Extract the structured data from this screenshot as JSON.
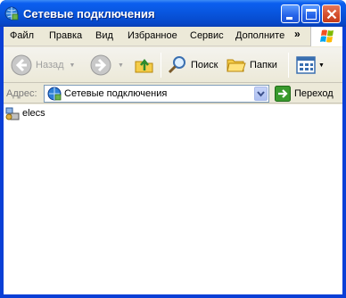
{
  "window": {
    "title": "Сетевые подключения"
  },
  "menubar": {
    "items": [
      "Файл",
      "Правка",
      "Вид",
      "Избранное",
      "Сервис",
      "Дополните"
    ],
    "overflow": "»"
  },
  "toolbar": {
    "back_label": "Назад",
    "search_label": "Поиск",
    "folders_label": "Папки"
  },
  "address": {
    "label": "Адрес:",
    "value": "Сетевые подключения",
    "go_label": "Переход"
  },
  "content": {
    "items": [
      {
        "name": "elecs",
        "icon": "network-connection-icon"
      }
    ]
  },
  "colors": {
    "titlebar": "#0855dd",
    "chrome": "#ece9d8",
    "close_button": "#d34d2b",
    "go_green": "#3a9a2e"
  }
}
